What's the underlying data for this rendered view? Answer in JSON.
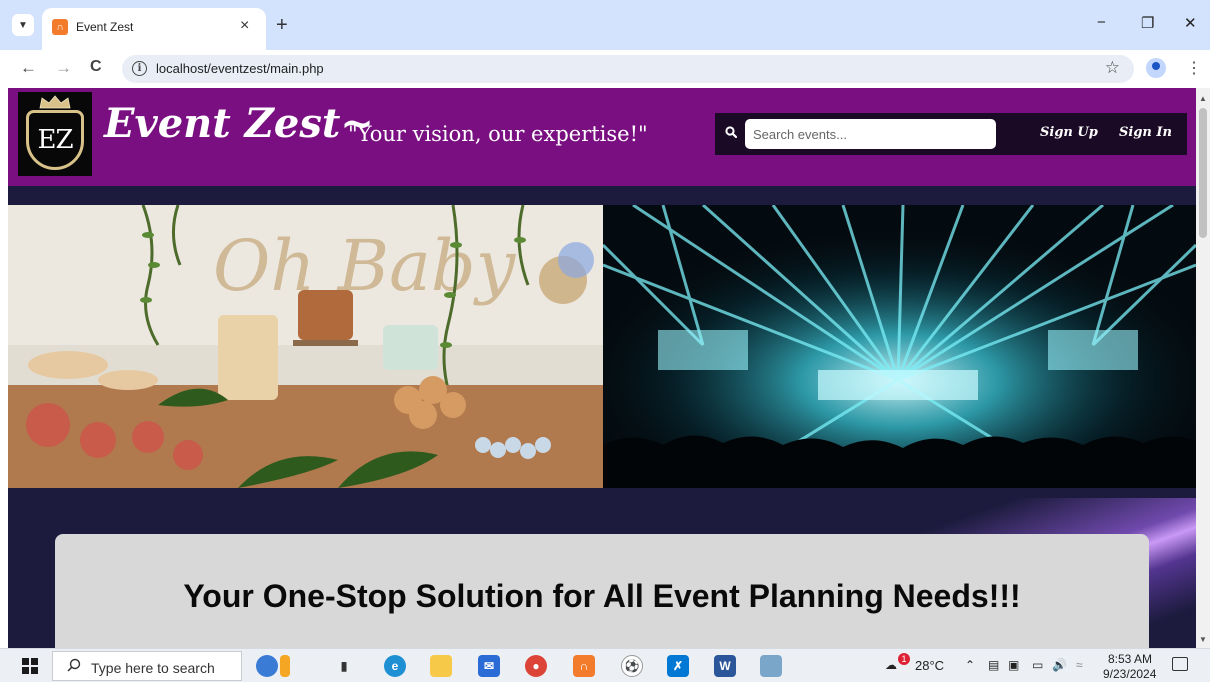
{
  "browser": {
    "tab_title": "Event Zest",
    "url": "localhost/eventzest/main.php",
    "tab_close": "×",
    "new_tab": "+",
    "min": "−",
    "restore": "❐",
    "close": "✕",
    "back": "←",
    "forward": "→",
    "reload": "C",
    "star": "☆",
    "menu": "⋮",
    "info": "i"
  },
  "header": {
    "logo_text": "EZ",
    "brand": "Event Zest~",
    "tagline": "\"Your vision, our expertise!\"",
    "search_placeholder": "Search events...",
    "sign_up": "Sign Up",
    "sign_in": "Sign In"
  },
  "hero": {
    "left_image": "baby-shower-dessert-table",
    "left_backdrop_text": "Oh Baby",
    "right_image": "concert-stage-lights"
  },
  "cta": {
    "heading": "Your One-Stop Solution for All Event Planning Needs!!!"
  },
  "taskbar": {
    "search_placeholder": "Type here to search",
    "temperature": "28°C",
    "time": "8:53 AM",
    "date": "9/23/2024",
    "weather_badge": "1"
  },
  "colors": {
    "header_purple": "#7a0f82",
    "page_navy": "#1c1b3d",
    "nav_dark": "#1a0a25",
    "cta_card": "#d8d8d8"
  }
}
